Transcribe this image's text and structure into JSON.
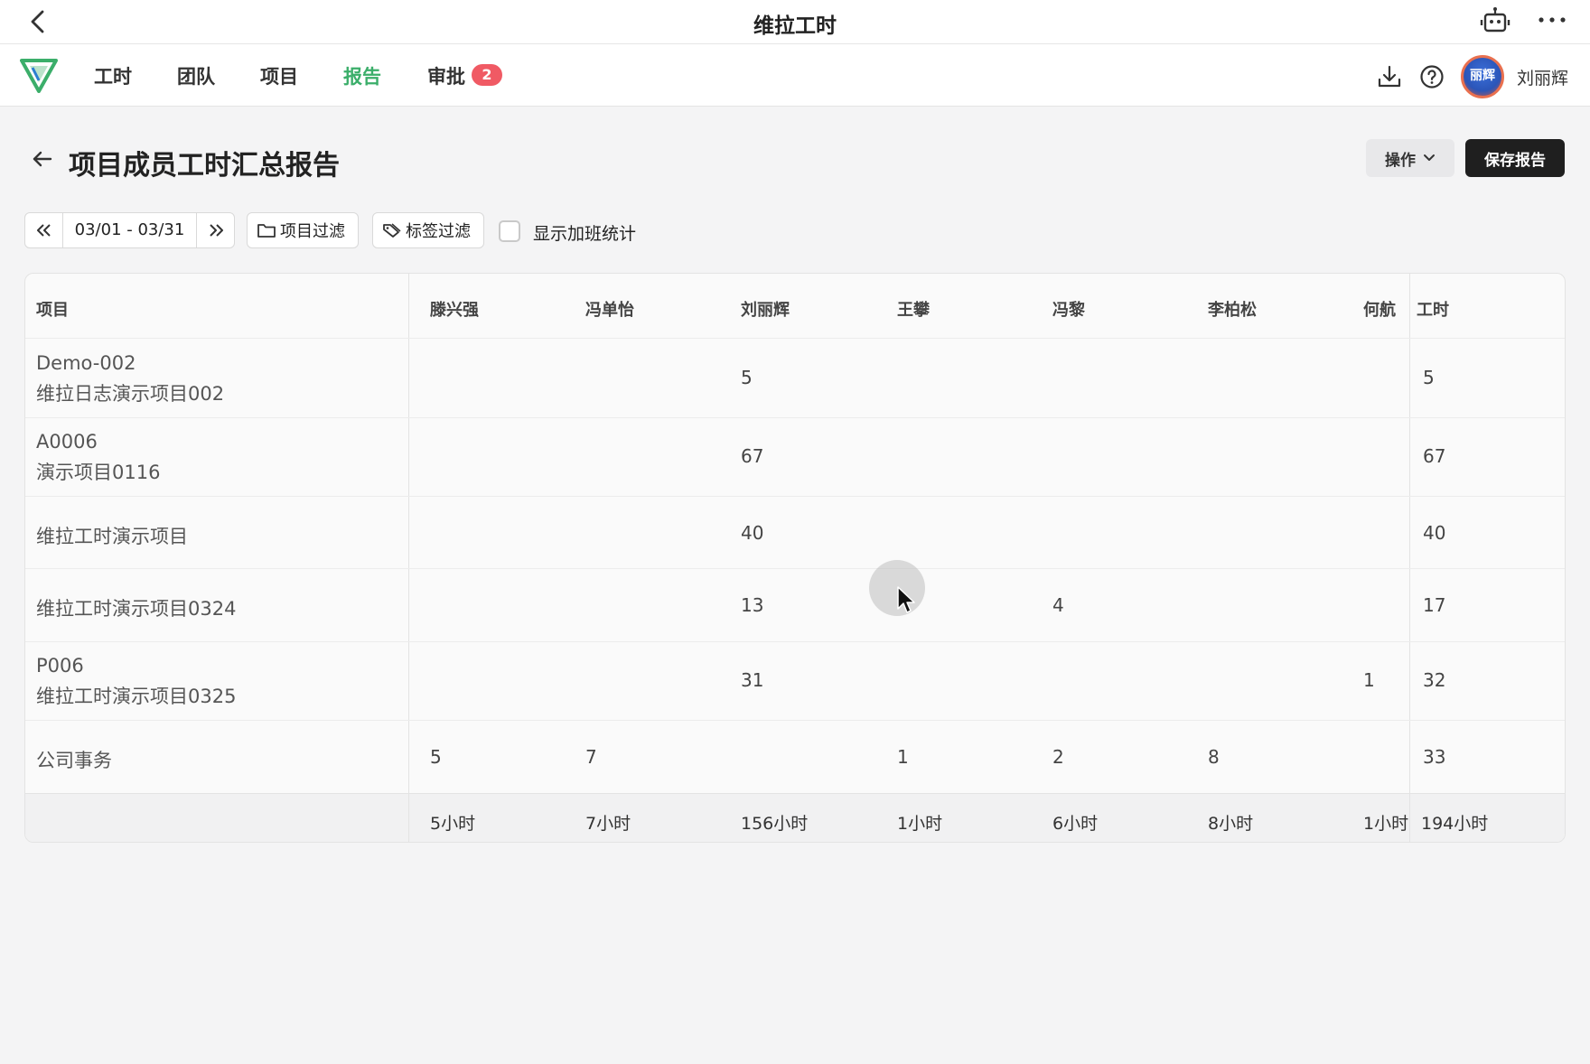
{
  "titlebar": {
    "title": "维拉工时"
  },
  "nav": {
    "items": [
      {
        "label": "工时",
        "active": false
      },
      {
        "label": "团队",
        "active": false
      },
      {
        "label": "项目",
        "active": false
      },
      {
        "label": "报告",
        "active": true
      },
      {
        "label": "审批",
        "active": false
      }
    ],
    "approval_badge": "2",
    "user": {
      "name": "刘丽辉",
      "avatar_text": "丽辉"
    },
    "active_color": "#3bae6a"
  },
  "page": {
    "title": "项目成员工时汇总报告",
    "ops_label": "操作",
    "save_label": "保存报告"
  },
  "filters": {
    "date_range": "03/01 - 03/31",
    "project_filter": "项目过滤",
    "tag_filter": "标签过滤",
    "overtime_label": "显示加班统计",
    "overtime_checked": false
  },
  "table": {
    "headers": [
      "项目",
      "滕兴强",
      "冯单怡",
      "刘丽辉",
      "王攀",
      "冯黎",
      "李柏松",
      "何航",
      "工时"
    ],
    "rows": [
      {
        "code": "Demo-002",
        "name": "维拉日志演示项目002",
        "values": [
          "",
          "",
          "5",
          "",
          "",
          "",
          ""
        ],
        "total": "5"
      },
      {
        "code": "A0006",
        "name": "演示项目0116",
        "values": [
          "",
          "",
          "67",
          "",
          "",
          "",
          ""
        ],
        "total": "67"
      },
      {
        "code": "",
        "name": "维拉工时演示项目",
        "values": [
          "",
          "",
          "40",
          "",
          "",
          "",
          ""
        ],
        "total": "40"
      },
      {
        "code": "",
        "name": "维拉工时演示项目0324",
        "values": [
          "",
          "",
          "13",
          "",
          "4",
          "",
          ""
        ],
        "total": "17"
      },
      {
        "code": "P006",
        "name": "维拉工时演示项目0325",
        "values": [
          "",
          "",
          "31",
          "",
          "",
          "",
          "1"
        ],
        "total": "32"
      },
      {
        "code": "",
        "name": "公司事务",
        "values": [
          "5",
          "7",
          "",
          "1",
          "2",
          "8",
          ""
        ],
        "total": "33"
      }
    ],
    "footer": [
      "5小时",
      "7小时",
      "156小时",
      "1小时",
      "6小时",
      "8小时",
      "1小时",
      "194小时"
    ]
  }
}
